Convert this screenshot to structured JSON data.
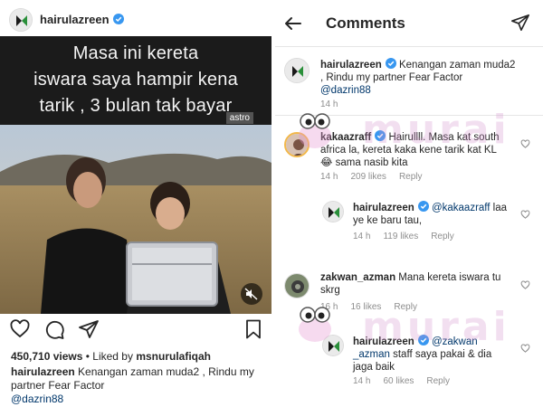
{
  "post": {
    "username": "hairulazreen",
    "media_text": [
      "Masa ini kereta",
      "iswara saya hampir kena",
      "tarik , 3 bulan tak bayar"
    ],
    "media_tag": "astro",
    "views": "450,710 views",
    "liked_by_prefix": " • Liked by ",
    "liked_by": "msnurulafiqah",
    "caption_user": "hairulazreen",
    "caption_text": " Kenangan zaman muda2 , Rindu my partner Fear Factor",
    "caption_mention": "@dazrin88"
  },
  "comments_header": {
    "title": "Comments"
  },
  "original": {
    "username": "hairulazreen",
    "text": " Kenangan zaman muda2 , Rindu my partner Fear Factor",
    "mention": "@dazrin88",
    "time": "14 h"
  },
  "comments": [
    {
      "username": "kakaazraff",
      "text": " Hairullll. Masa kat south africa la, kereta kaka kene tarik kat KL 😂 sama nasib kita",
      "time": "14 h",
      "likes": "209 likes",
      "reply": "Reply"
    },
    {
      "username": "hairulazreen",
      "mention": "@kakaazraff",
      "text": " laa ye ke baru tau,",
      "time": "14 h",
      "likes": "119 likes",
      "reply": "Reply"
    },
    {
      "username": "zakwan_azman",
      "text": " Mana kereta iswara tu skrg",
      "time": "16 h",
      "likes": "16 likes",
      "reply": "Reply"
    },
    {
      "username": "hairulazreen",
      "mention": "@zakwan _azman",
      "text": " staff saya pakai & dia jaga baik",
      "time": "14 h",
      "likes": "60 likes",
      "reply": "Reply"
    }
  ],
  "watermark": "murai",
  "colors": {
    "verified": "#3897f0",
    "mention": "#00376b",
    "meta": "#8e8e8e"
  },
  "icons": [
    "verified-icon",
    "heart-icon",
    "comment-icon",
    "share-icon",
    "bookmark-icon",
    "mute-icon",
    "back-arrow-icon",
    "send-icon"
  ]
}
